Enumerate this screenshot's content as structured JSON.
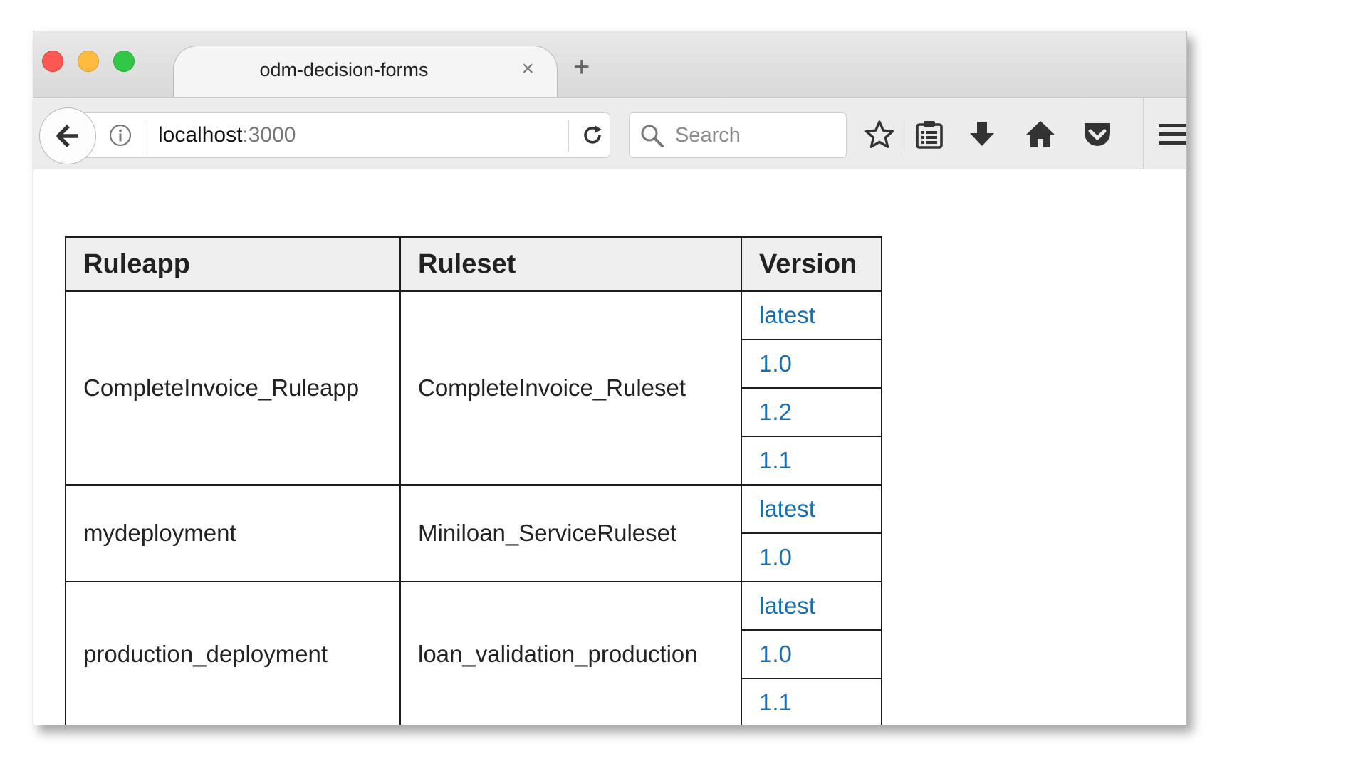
{
  "browser": {
    "tab_title": "odm-decision-forms",
    "tab_close": "×",
    "new_tab": "+",
    "url_host": "localhost",
    "url_port": ":3000",
    "search_placeholder": "Search"
  },
  "table": {
    "headers": {
      "ruleapp": "Ruleapp",
      "ruleset": "Ruleset",
      "version": "Version"
    },
    "rows": [
      {
        "ruleapp": "CompleteInvoice_Ruleapp",
        "ruleset": "CompleteInvoice_Ruleset",
        "versions": [
          "latest",
          "1.0",
          "1.2",
          "1.1"
        ]
      },
      {
        "ruleapp": "mydeployment",
        "ruleset": "Miniloan_ServiceRuleset",
        "versions": [
          "latest",
          "1.0"
        ]
      },
      {
        "ruleapp": "production_deployment",
        "ruleset": "loan_validation_production",
        "versions": [
          "latest",
          "1.0",
          "1.1"
        ]
      }
    ]
  },
  "colors": {
    "link": "#1a6fb3",
    "header_bg": "#efefef",
    "close_red": "#fc5753",
    "minimize_yellow": "#fdbc40",
    "zoom_green": "#33c748"
  }
}
